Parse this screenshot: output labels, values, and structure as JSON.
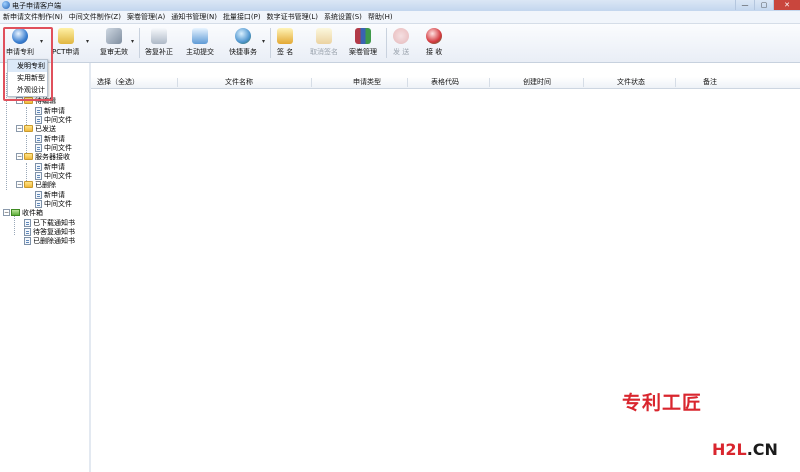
{
  "window": {
    "title": "电子申请客户端",
    "min": "—",
    "max": "▢",
    "close": "✕"
  },
  "menubar": [
    "新申请文件制作(N)",
    "中间文件制作(Z)",
    "案卷管理(A)",
    "通知书管理(N)",
    "批量接口(P)",
    "数字证书管理(L)",
    "系统设置(S)",
    "帮助(H)"
  ],
  "toolbar": {
    "apply_patent": "申请专利",
    "pct": "PCT申请",
    "reexam_invalid": "复审无效",
    "supplement": "答复补正",
    "voluntary": "主动提交",
    "shortcut": "快捷事务",
    "sign": "签 名",
    "cancel_sign": "取消签名",
    "case_manage": "案卷管理",
    "send": "发 送",
    "receive": "接 收"
  },
  "dropdown": [
    "发明专利",
    "实用新型",
    "外观设计"
  ],
  "tree": {
    "to_edit": "待编辑",
    "new_app": "新申请",
    "mid_file": "中间文件",
    "sent": "已发送",
    "server_recv": "服务器接收",
    "deleted": "已删除",
    "inbox": "收件箱",
    "downloaded": "已下载通知书",
    "pending": "待答复通知书",
    "deleted_notice": "已删除通知书"
  },
  "table": {
    "columns": [
      "选择（全选）",
      "文件名称",
      "申请类型",
      "表格代码",
      "创建时间",
      "文件状态",
      "备注"
    ]
  },
  "watermark": {
    "text1": "专利工匠",
    "h2l": "H2L",
    "cn": ".CN"
  },
  "colors": {
    "accent_red": "#d9262e",
    "titlebar": "#c3d6ee"
  }
}
